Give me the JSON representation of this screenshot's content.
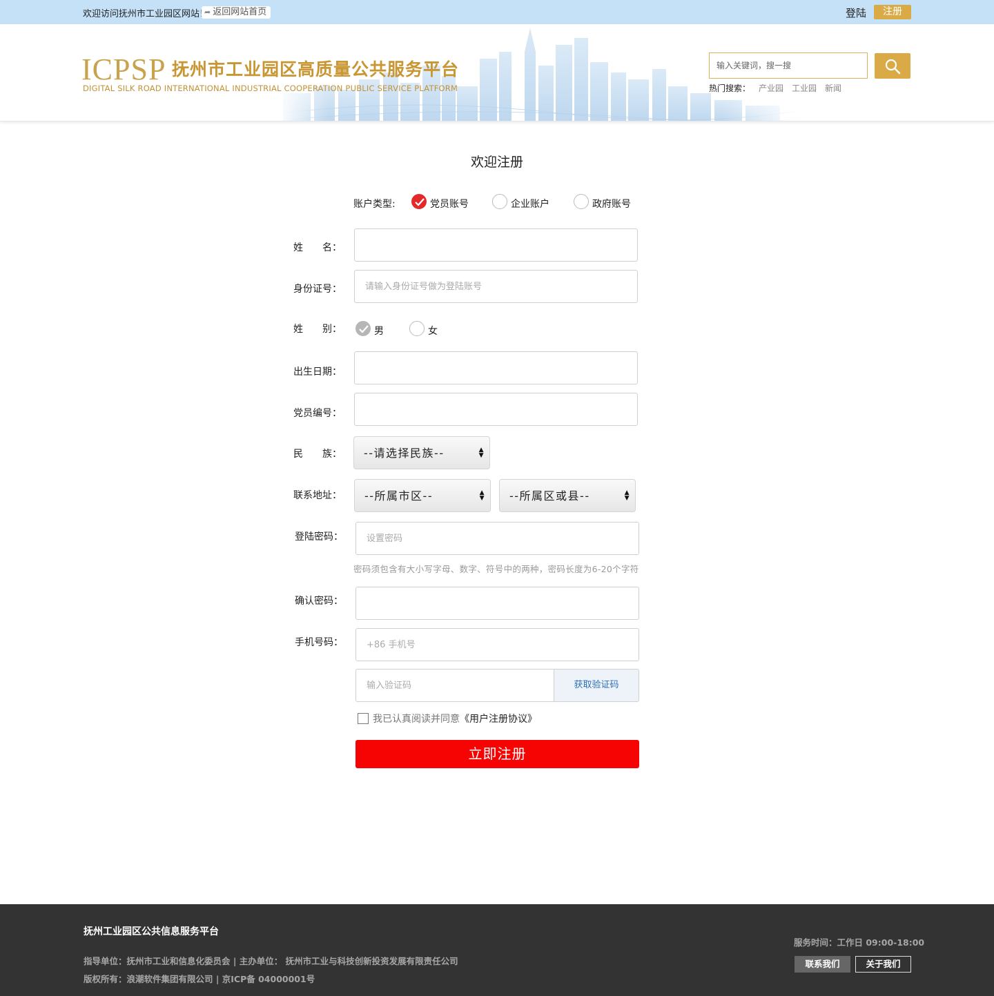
{
  "topbar": {
    "welcome": "欢迎访问抚州市工业园区网站！",
    "home_link": "返回网站首页",
    "login": "登陆",
    "register": "注册"
  },
  "header": {
    "logo_mark": "ICPSP",
    "logo_title": "抚州市工业园区高质量公共服务平台",
    "logo_subtitle": "DIGITAL SILK ROAD INTERNATIONAL INDUSTRIAL COOPERATION PUBLIC SERVICE PLATFORM",
    "search_placeholder": "输入关键词，搜一搜",
    "hot_label": "热门搜索：",
    "hot_items": [
      "产业园",
      "工业园",
      "新闻"
    ]
  },
  "form": {
    "title": "欢迎注册",
    "account_type_label": "账户类型:",
    "account_types": [
      "党员账号",
      "企业账户",
      "政府账号"
    ],
    "account_type_selected": "党员账号",
    "name_label": "姓　　名：",
    "id_label": "身份证号：",
    "id_placeholder": "请输入身份证号做为登陆账号",
    "gender_label": "姓　　别：",
    "genders": [
      "男",
      "女"
    ],
    "gender_selected": "男",
    "birth_label": "出生日期：",
    "member_no_label": "党员编号：",
    "ethnic_label": "民　　族：",
    "ethnic_select": "--请选择民族--",
    "address_label": "联系地址：",
    "city_select": "--所属市区--",
    "county_select": "--所属区或县--",
    "password_label": "登陆密码：",
    "password_placeholder": "设置密码",
    "password_hint": "密码须包含有大小写字母、数字、符号中的两种，密码长度为6-20个字符",
    "confirm_label": "确认密码：",
    "phone_label": "手机号码：",
    "phone_placeholder": "+86 手机号",
    "code_placeholder": "输入验证码",
    "code_button": "获取验证码",
    "agree_text": "我已认真阅读并同意",
    "agree_protocol": "《用户注册协议》",
    "submit": "立即注册"
  },
  "footer": {
    "title": "抚州工业园区公共信息服务平台",
    "line1": "指导单位：抚州市工业和信息化委员会 | 主办单位： 抚州市工业与科技创新投资发展有限责任公司",
    "line2": "版权所有：浪潮软件集团有限公司 | 京ICP备 04000001号",
    "service_time": "服务时间：工作日  09:00-18:00",
    "contact_button": "联系我们",
    "about_button": "关于我们"
  },
  "colors": {
    "topbar_bg": "#c5e1f8",
    "accent_gold": "#d9aa45",
    "submit_red": "#f60303",
    "footer_bg": "#333333",
    "radio_checked": "#e4292a"
  }
}
